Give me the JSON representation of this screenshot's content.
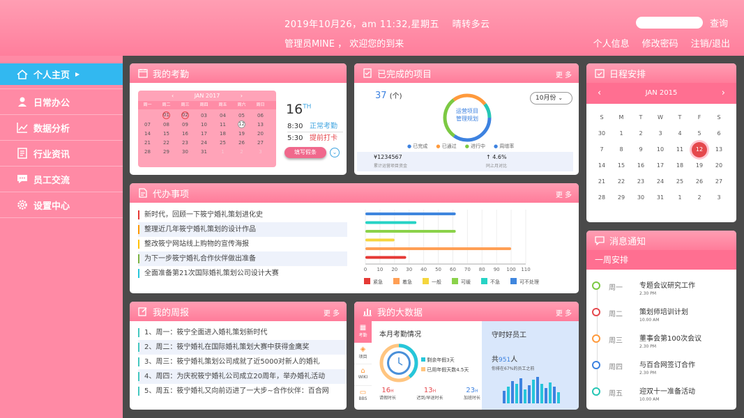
{
  "header": {
    "datetime": "2019年10月26，am 11:32,星期五",
    "weather": "晴转多云",
    "greeting": "管理员MINE ， 欢迎您的到来",
    "search_placeholder": "",
    "search_button": "查询",
    "links": [
      "个人信息",
      "修改密码",
      "注销/退出"
    ]
  },
  "sidebar": {
    "items": [
      {
        "label": "个人主页",
        "icon": "home-icon"
      },
      {
        "label": "日常办公",
        "icon": "user-icon"
      },
      {
        "label": "数据分析",
        "icon": "chart-line-icon"
      },
      {
        "label": "行业资讯",
        "icon": "news-icon"
      },
      {
        "label": "员工交流",
        "icon": "chat-icon"
      },
      {
        "label": "设置中心",
        "icon": "gear-icon"
      }
    ]
  },
  "attendance": {
    "title": "我的考勤",
    "cal_month": "JAN  2017",
    "weekdays": [
      "周一",
      "周二",
      "周三",
      "周四",
      "周五",
      "周六",
      "周日"
    ],
    "rows": [
      [
        "",
        "01",
        "02",
        "03",
        "04",
        "05",
        "06"
      ],
      [
        "07",
        "08",
        "09",
        "10",
        "11",
        "12",
        "13"
      ],
      [
        "14",
        "15",
        "16",
        "17",
        "18",
        "19",
        "20"
      ],
      [
        "21",
        "22",
        "23",
        "24",
        "25",
        "26",
        "27"
      ],
      [
        "28",
        "29",
        "30",
        "31",
        "1",
        "2",
        "3"
      ]
    ],
    "day": "16",
    "day_suffix": "TH",
    "time1": "8:30",
    "status1": "正常考勤",
    "time2": "5:30",
    "status2": "提前打卡",
    "button": "填写假条"
  },
  "projects": {
    "title": "已完成的项目",
    "more": "更 多",
    "count": "37",
    "unit": "(个)",
    "month_select": "10月份",
    "ring_l1": "运营项目",
    "ring_l2": "管理规划",
    "legend": [
      "已完成",
      "已通过",
      "进行中",
      "周增率"
    ],
    "stat1_val": "¥1234567",
    "stat1_lbl": "累计运营项目资金",
    "stat2_val": "4.6%",
    "stat2_lbl": "同上月对比"
  },
  "todo": {
    "title": "代办事项",
    "more": "更 多",
    "items": [
      "新时代，回顾一下筱宁婚礼策划进化史",
      "整理近几年筱宁婚礼策划的设计作品",
      "整改筱宁网站线上购物的宣传海报",
      "为下一步筱宁婚礼合作伙伴做出准备",
      "全面准备第21次国际婚礼策划公司设计大赛"
    ],
    "item_colors": [
      "#e53935",
      "#ff9800",
      "#ffc107",
      "#7cb342",
      "#26c6da"
    ]
  },
  "chart_data": {
    "type": "bar",
    "orientation": "horizontal",
    "xlim": [
      0,
      110
    ],
    "ticks": [
      0,
      10,
      20,
      30,
      40,
      50,
      60,
      70,
      80,
      90,
      100,
      110
    ],
    "series": [
      {
        "name": "紧急",
        "color": "#e53935",
        "value": 28
      },
      {
        "name": "着急",
        "color": "#ff9f55",
        "value": 100
      },
      {
        "name": "一般",
        "color": "#f5d63d",
        "value": 20
      },
      {
        "name": "可缓",
        "color": "#8bd24a",
        "value": 62
      },
      {
        "name": "不急",
        "color": "#26d3c5",
        "value": 35
      },
      {
        "name": "可不处理",
        "color": "#3f86de",
        "value": 62
      }
    ]
  },
  "weekly": {
    "title": "我的周报",
    "more": "更 多",
    "items": [
      "1、周一：筱宁全面进入婚礼策划新时代",
      "2、周二：筱宁婚礼在国际婚礼策划大赛中获得金鹰奖",
      "3、周三：筱宁婚礼策划公司成就了近5000对新人的婚礼",
      "4、周四：为庆祝筱宁婚礼公司成立20周年，举办婚礼活动",
      "5、周五：筱宁婚礼又向前迈进了一大步~合作伙伴：百合网"
    ]
  },
  "bigdata": {
    "title": "我的大数据",
    "more": "更 多",
    "tabs": [
      "考勤",
      "项目",
      "WIKI",
      "BBS"
    ],
    "sec_title": "本月考勤情况",
    "leg1": "剩余年假3天",
    "leg2": "已用年假天数4.5天",
    "s1_val": "16",
    "s1_unit": "H",
    "s1_lbl": "请假时长",
    "s2_val": "13",
    "s2_unit": "H",
    "s2_lbl": "迟到/早退时长",
    "s3_val": "23",
    "s3_unit": "H",
    "s3_lbl": "加班时长",
    "emp_title": "守时好员工",
    "emp_count_pre": "共",
    "emp_count": "951",
    "emp_count_post": "人",
    "emp_desc": "你排在67%的员工之前",
    "emp_bars": [
      0.45,
      0.6,
      0.8,
      0.7,
      0.9,
      0.5,
      0.65,
      0.85,
      0.95,
      0.7,
      0.55,
      0.75,
      0.6,
      0.4
    ]
  },
  "schedule": {
    "title": "日程安排",
    "cal_month": "JAN   2015",
    "weekdays": [
      "S",
      "M",
      "T",
      "W",
      "T",
      "F",
      "S"
    ],
    "rows": [
      [
        "30",
        "1",
        "2",
        "3",
        "4",
        "5",
        "6"
      ],
      [
        "7",
        "8",
        "9",
        "10",
        "11",
        "12",
        "13"
      ],
      [
        "14",
        "15",
        "16",
        "17",
        "18",
        "19",
        "20"
      ],
      [
        "21",
        "22",
        "23",
        "24",
        "25",
        "26",
        "27"
      ],
      [
        "28",
        "29",
        "30",
        "31",
        "1",
        "2",
        "3"
      ]
    ]
  },
  "notice": {
    "title": "消息通知",
    "subtitle": "一周安排",
    "items": [
      {
        "day": "周一",
        "title": "专题会议研究工作",
        "time": "2.30 PM",
        "color": "#7cc943"
      },
      {
        "day": "周二",
        "title": "策划师培训计划",
        "time": "10.00 AM",
        "color": "#e5484d"
      },
      {
        "day": "周三",
        "title": "董事会第100次会议",
        "time": "2.30 PM",
        "color": "#ff9a3c"
      },
      {
        "day": "周四",
        "title": "与百合网签订合作",
        "time": "2.30 PM",
        "color": "#3d82e0"
      },
      {
        "day": "周五",
        "title": "迎双十一准备活动",
        "time": "10.00 AM",
        "color": "#26c6b5"
      }
    ]
  }
}
